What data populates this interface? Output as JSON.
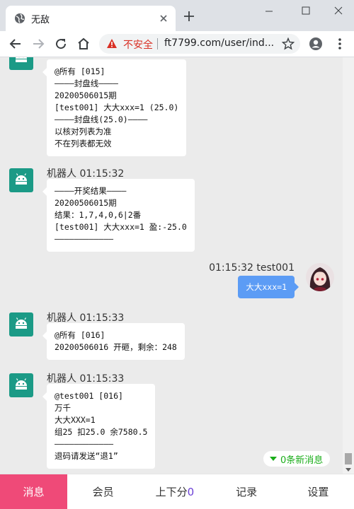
{
  "browser": {
    "tab_title": "无敌",
    "insecure_label": "不安全",
    "url": "ft7799.com/user/ind..."
  },
  "messages": [
    {
      "sender": "",
      "text": "@所有 [015]\n————封盘线————\n20200506015期\n[test001] 大大xxx=1 (25.0)\n————封盘线(25.0)————\n以核对列表为准\n不在列表都无效"
    },
    {
      "sender": "机器人 01:15:32",
      "text": "————开奖结果————\n20200506015期\n结果：1,7,4,0,6|2番\n[test001] 大大xxx=1 盈:-25.0\n————————————"
    },
    {
      "sender": "01:15:32 test001",
      "text": "大大xxx=1"
    },
    {
      "sender": "机器人 01:15:33",
      "text": "@所有 [016]\n20200506016 开砸，剩余：248"
    },
    {
      "sender": "机器人 01:15:33",
      "text": "@test001 [016]\n万千\n大大XXX=1\n组25 扣25.0 余7580.5\n————————————\n退码请发送“退1”"
    }
  ],
  "new_messages_label": "0条新消息",
  "nav": {
    "items": [
      "消息",
      "会员",
      "上下分",
      "记录",
      "设置"
    ],
    "balance_count": "0"
  },
  "colors": {
    "robot_avatar": "#1b9a86",
    "my_bubble": "#5c9cf5",
    "active_nav": "#ef4a78",
    "insecure": "#d93025"
  }
}
